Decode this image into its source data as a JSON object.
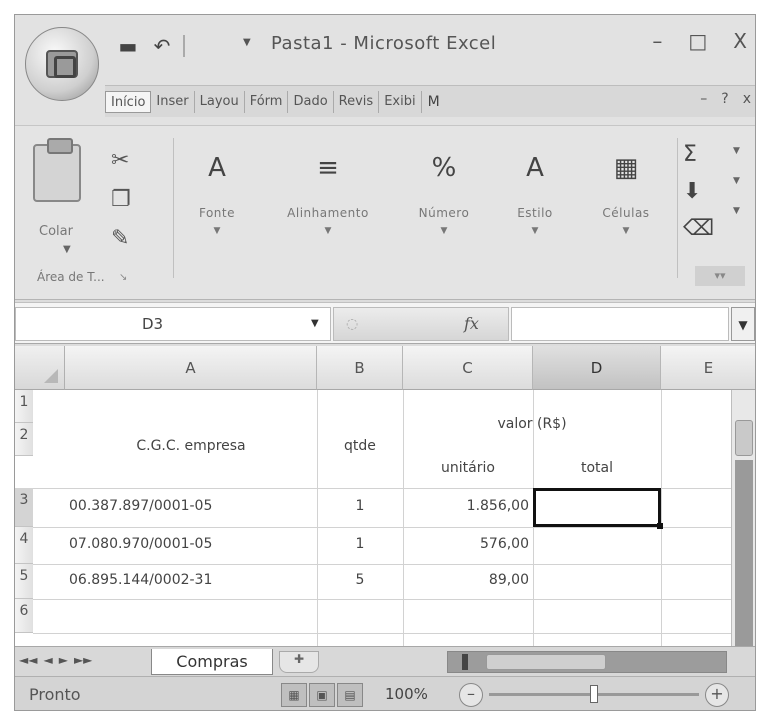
{
  "window": {
    "title": "Pasta1 - Microsoft Excel",
    "controls": [
      "–",
      "□",
      "X"
    ]
  },
  "ribbon": {
    "tabs": [
      "Início",
      "Inser",
      "Layou",
      "Fórm",
      "Dado",
      "Revis",
      "Exibi"
    ],
    "tab_extra": "M",
    "clipboard": {
      "paste_label": "Colar",
      "group_label": "Área de T..."
    },
    "groups": [
      {
        "id": "fonte",
        "label": "Fonte",
        "icon": "A"
      },
      {
        "id": "alinhamento",
        "label": "Alinhamento",
        "icon": "≡"
      },
      {
        "id": "numero",
        "label": "Número",
        "icon": "%"
      },
      {
        "id": "estilo",
        "label": "Estilo",
        "icon": "A"
      },
      {
        "id": "celulas",
        "label": "Células",
        "icon": "▦"
      }
    ],
    "editing_icons": [
      "Σ",
      "⬇",
      "⌫"
    ]
  },
  "formula_bar": {
    "name_box": "D3",
    "fx": "fx",
    "value": ""
  },
  "grid": {
    "columns": [
      "A",
      "B",
      "C",
      "D",
      "E"
    ],
    "selected_column": "D",
    "rows": [
      "1",
      "2",
      "3",
      "4",
      "5",
      "6"
    ],
    "selected_row": "3",
    "header": {
      "company": "C.G.C. empresa",
      "qty": "qtde",
      "value": "valor (R$)",
      "unit": "unitário",
      "total": "total"
    },
    "data": [
      {
        "cnpj": "00.387.897/0001-05",
        "qtde": "1",
        "unit": "1.856,00"
      },
      {
        "cnpj": "07.080.970/0001-05",
        "qtde": "1",
        "unit": "576,00"
      },
      {
        "cnpj": "06.895.144/0002-31",
        "qtde": "5",
        "unit": "89,00"
      }
    ]
  },
  "sheets": {
    "active": "Compras",
    "nav": [
      "◄◄",
      "◄",
      "►",
      "►►"
    ]
  },
  "status": {
    "text": "Pronto",
    "zoom": "100%",
    "zoom_fraction": 0.5
  }
}
